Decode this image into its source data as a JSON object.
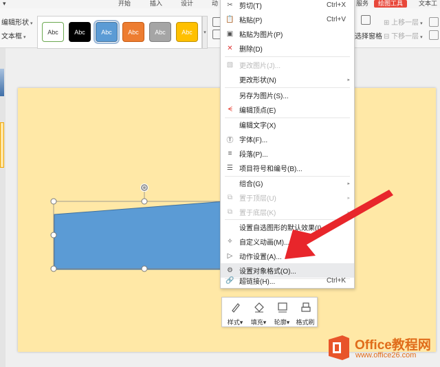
{
  "ribbon": {
    "tabs": [
      {
        "label": "开始",
        "active": false
      },
      {
        "label": "插入",
        "active": false
      },
      {
        "label": "设计",
        "active": false
      },
      {
        "label": "动",
        "active": false
      },
      {
        "label": "服务",
        "active": false
      },
      {
        "label": "绘图工具",
        "active": true
      },
      {
        "label": "文本工",
        "active": false
      }
    ],
    "edit_shape": "编辑形状",
    "text_box": "文本框",
    "style_swatches": [
      {
        "label": "Abc",
        "bg": "#ffffff",
        "fg": "#333333",
        "border": "#6aa84f"
      },
      {
        "label": "Abc",
        "bg": "#000000",
        "fg": "#ffffff",
        "border": "#000000"
      },
      {
        "label": "Abc",
        "bg": "#5b9bd5",
        "fg": "#ffffff",
        "border": "#41719c"
      },
      {
        "label": "Abc",
        "bg": "#ed7d31",
        "fg": "#ffffff",
        "border": "#c55a11"
      },
      {
        "label": "Abc",
        "bg": "#a5a5a5",
        "fg": "#ffffff",
        "border": "#7f7f7f"
      },
      {
        "label": "Abc",
        "bg": "#ffc000",
        "fg": "#ffffff",
        "border": "#bf9000"
      }
    ],
    "selection_pane": "选择窗格",
    "bring_forward": "上移一层",
    "send_backward": "下移一层"
  },
  "context_menu": {
    "items": [
      {
        "label": "剪切(T)",
        "shortcut": "Ctrl+X",
        "icon": "scissors-icon",
        "disabled": false
      },
      {
        "label": "粘贴(P)",
        "shortcut": "Ctrl+V",
        "icon": "paste-icon",
        "disabled": false
      },
      {
        "label": "粘贴为图片(P)",
        "icon": "paste-image-icon",
        "disabled": false
      },
      {
        "label": "删除(D)",
        "icon": "delete-x-icon",
        "disabled": false
      },
      {
        "label": "更改图片(J)...",
        "icon": "image-icon",
        "disabled": true
      },
      {
        "label": "更改形状(N)",
        "submenu": true,
        "disabled": false
      },
      {
        "label": "另存为图片(S)...",
        "disabled": false
      },
      {
        "label": "编辑顶点(E)",
        "icon": "edit-points-icon",
        "disabled": false
      },
      {
        "label": "编辑文字(X)",
        "disabled": false
      },
      {
        "label": "字体(F)...",
        "icon": "font-icon",
        "disabled": false
      },
      {
        "label": "段落(P)...",
        "icon": "paragraph-icon",
        "disabled": false
      },
      {
        "label": "项目符号和编号(B)...",
        "icon": "bullets-icon",
        "disabled": false
      },
      {
        "label": "组合(G)",
        "submenu": true,
        "disabled": false
      },
      {
        "label": "置于顶层(U)",
        "submenu": true,
        "icon": "bring-front-icon",
        "disabled": true
      },
      {
        "label": "置于底层(K)",
        "submenu": true,
        "icon": "send-back-icon",
        "disabled": true
      },
      {
        "label": "设置自选图形的默认效果(I)",
        "disabled": false
      },
      {
        "label": "自定义动画(M)...",
        "icon": "animation-icon",
        "disabled": false
      },
      {
        "label": "动作设置(A)...",
        "icon": "action-icon",
        "disabled": false
      },
      {
        "label": "设置对象格式(O)...",
        "icon": "format-object-icon",
        "disabled": false,
        "highlighted": true
      },
      {
        "label": "超链接(H)...",
        "shortcut": "Ctrl+K",
        "icon": "hyperlink-icon",
        "disabled": false
      }
    ]
  },
  "mini_toolbar": {
    "style": "样式",
    "fill": "填充",
    "outline": "轮廓",
    "format_painter": "格式刷"
  },
  "watermark": {
    "title": "Office教程网",
    "url": "www.office26.com"
  },
  "colors": {
    "slide_bg": "#ffe8a6",
    "shape_fill": "#5b9bd5",
    "arrow": "#e8262b",
    "accent": "#e8473a"
  }
}
